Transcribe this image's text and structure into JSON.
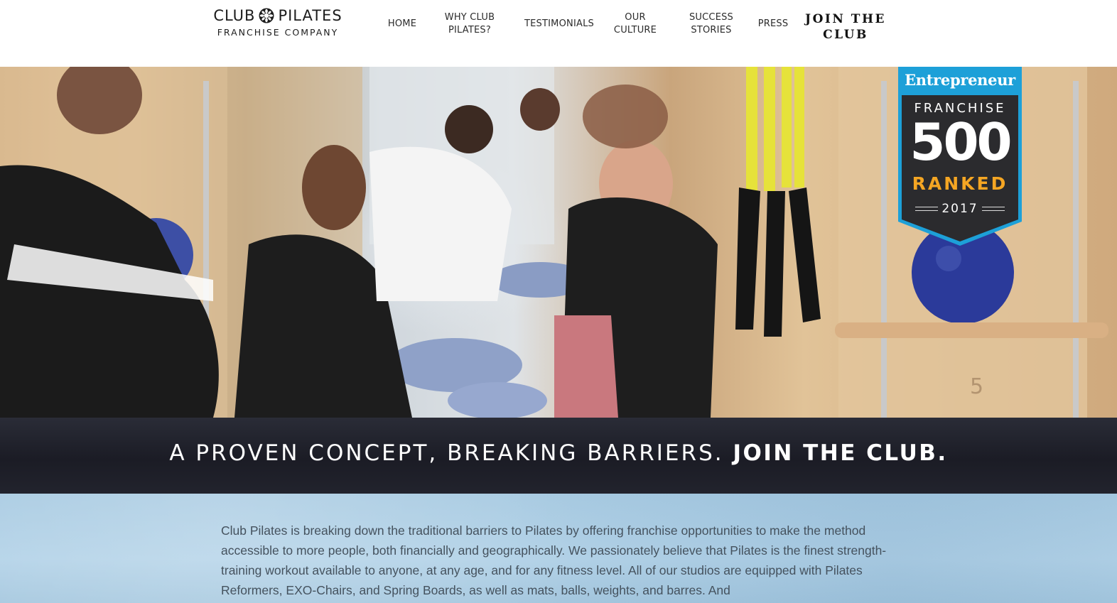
{
  "header": {
    "logo": {
      "line1_left": "CLUB",
      "line1_right": "PILATES",
      "line2": "FRANCHISE COMPANY"
    },
    "nav": [
      {
        "label": "HOME"
      },
      {
        "label": "WHY CLUB\nPILATES?"
      },
      {
        "label": "TESTIMONIALS"
      },
      {
        "label": "OUR\nCULTURE"
      },
      {
        "label": "SUCCESS\nSTORIES"
      },
      {
        "label": "PRESS"
      },
      {
        "label": "JOIN THE\nCLUB"
      }
    ]
  },
  "hero": {
    "badge": {
      "brand": "Entrepreneur",
      "line1": "FRANCHISE",
      "number": "500",
      "ranked": "RANKED",
      "year": "2017"
    },
    "colors": {
      "badge_blue": "#1da0d8",
      "badge_dark": "#2b2b2e",
      "badge_orange": "#f5a623"
    }
  },
  "tagline": {
    "regular": "A PROVEN CONCEPT, BREAKING BARRIERS.",
    "strong": "JOIN THE CLUB."
  },
  "body": {
    "paragraph": "Club Pilates is breaking down the traditional barriers to Pilates by offering franchise opportunities to make the method accessible to more people, both financially and geographically. We passionately believe that Pilates is the finest strength-training workout available to anyone, at any age, and for any fitness level. All of our studios are equipped with Pilates Reformers, EXO-Chairs, and Spring Boards, as well as mats, balls, weights, and barres. And"
  }
}
